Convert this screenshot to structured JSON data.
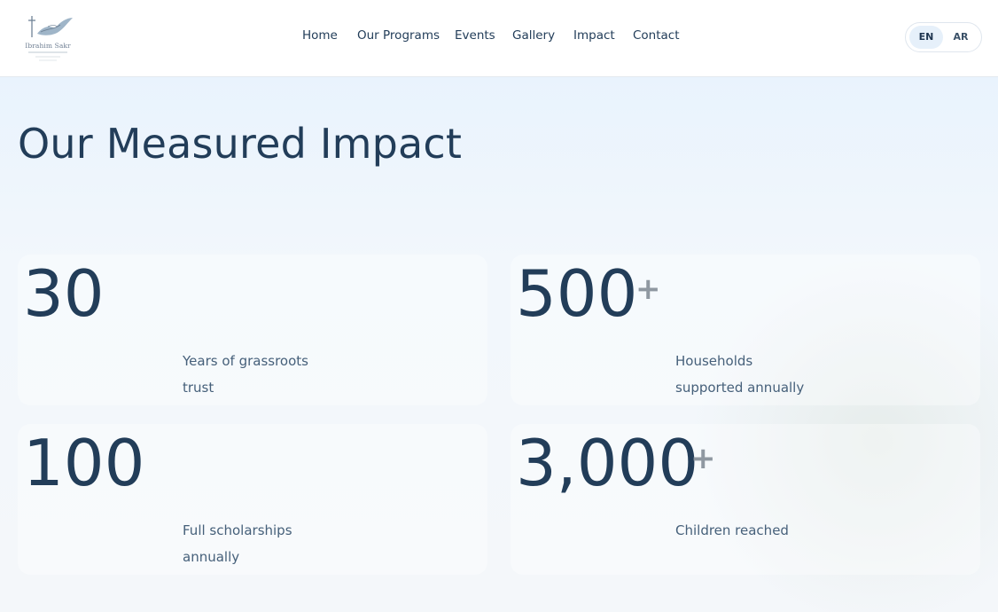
{
  "header": {
    "logo": {
      "name": "Ibrahim Sakr"
    },
    "nav": [
      {
        "label": "Home"
      },
      {
        "label": "Our Programs"
      },
      {
        "label": "Events"
      },
      {
        "label": "Gallery"
      },
      {
        "label": "Impact"
      },
      {
        "label": "Contact"
      }
    ],
    "language": {
      "options": [
        "EN",
        "AR"
      ],
      "selected": "EN"
    }
  },
  "impact": {
    "title": "Our Measured Impact",
    "stats": [
      {
        "number": "30",
        "suffix": "",
        "label_line1": "Years of grassroots",
        "label_line2": "trust"
      },
      {
        "number": "500",
        "suffix": "+",
        "label_line1": "Households",
        "label_line2": "supported annually"
      },
      {
        "number": "100",
        "suffix": "",
        "label_line1": "Full scholarships",
        "label_line2": "annually"
      },
      {
        "number": "3,000",
        "suffix": "+",
        "label_line1": "Children reached",
        "label_line2": ""
      }
    ]
  },
  "colors": {
    "text": "#223d59",
    "muted": "#46607a",
    "suffix": "#8f98a1",
    "accent_bg": "#e6f0fa"
  }
}
